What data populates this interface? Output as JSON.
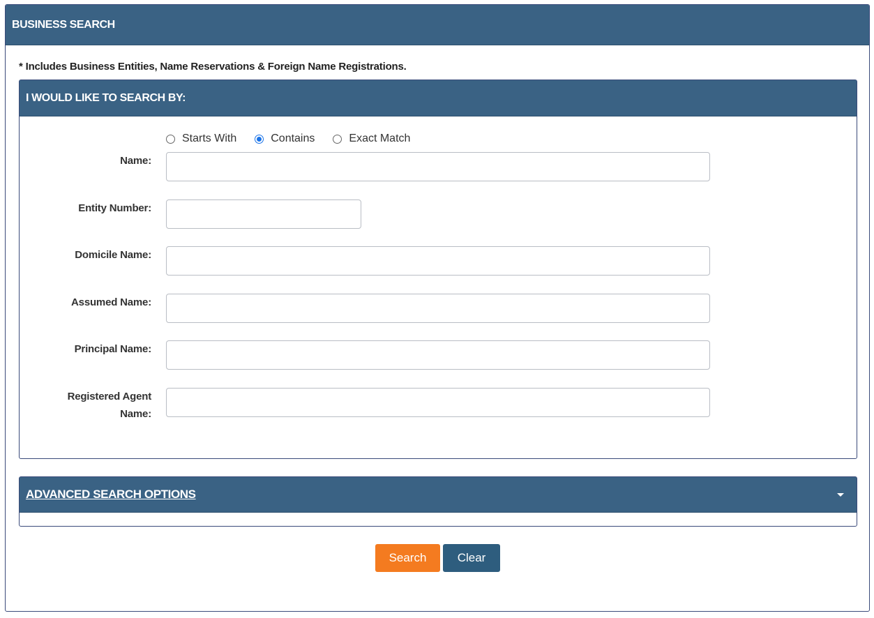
{
  "header": {
    "title": "BUSINESS SEARCH"
  },
  "note": "* Includes Business Entities, Name Reservations & Foreign Name Registrations.",
  "search_by": {
    "title": "I WOULD LIKE TO SEARCH BY:",
    "match_options": [
      {
        "label": "Starts With",
        "checked": false
      },
      {
        "label": "Contains",
        "checked": true
      },
      {
        "label": "Exact Match",
        "checked": false
      }
    ],
    "fields": {
      "name": {
        "label": "Name:",
        "value": ""
      },
      "entity_number": {
        "label": "Entity Number:",
        "value": ""
      },
      "domicile_name": {
        "label": "Domicile Name:",
        "value": ""
      },
      "assumed_name": {
        "label": "Assumed Name:",
        "value": ""
      },
      "principal_name": {
        "label": "Principal Name:",
        "value": ""
      },
      "registered_agent_name": {
        "label_line1": "Registered Agent",
        "label_line2": "Name:",
        "value": ""
      }
    }
  },
  "advanced": {
    "title": "ADVANCED SEARCH OPTIONS",
    "icon": "caret-down-icon"
  },
  "buttons": {
    "search": "Search",
    "clear": "Clear"
  },
  "colors": {
    "header_bg": "#3a6284",
    "search_button": "#f47b20",
    "clear_button": "#2e5d7e",
    "radio_selected": "#1a73e8"
  }
}
